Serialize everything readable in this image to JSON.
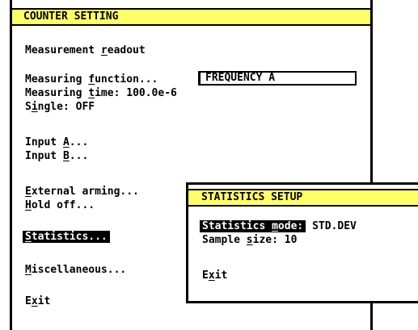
{
  "colors": {
    "titlebar": "#ffff66",
    "text": "#000000",
    "highlight_bg": "#000000",
    "highlight_text": "#ffffff"
  },
  "counter_setting": {
    "title": "COUNTER SETTING",
    "measurement_readout": {
      "label": "Measurement ",
      "hotkey": "r",
      "rest": "eadout"
    },
    "measuring_function": {
      "label": "Measuring ",
      "hotkey": "f",
      "rest": "unction...",
      "value": "FREQUENCY A"
    },
    "measuring_time": {
      "label": "Measuring ",
      "hotkey": "t",
      "rest": "ime: 100.0e-6"
    },
    "single": {
      "label": "S",
      "hotkey": "i",
      "rest": "ngle: OFF"
    },
    "input_a": {
      "label": "Input ",
      "hotkey": "A",
      "rest": "..."
    },
    "input_b": {
      "label": "Input ",
      "hotkey": "B",
      "rest": "..."
    },
    "external_arming": {
      "label": "",
      "hotkey": "E",
      "rest": "xternal arming..."
    },
    "hold_off": {
      "label": "",
      "hotkey": "H",
      "rest": "old off..."
    },
    "statistics": {
      "label": "",
      "hotkey": "S",
      "rest": "tatistics..."
    },
    "miscellaneous": {
      "label": "",
      "hotkey": "M",
      "rest": "iscellaneous..."
    },
    "exit": {
      "label": "E",
      "hotkey": "x",
      "rest": "it"
    }
  },
  "statistics_setup": {
    "title": "STATISTICS SETUP",
    "statistics_mode": {
      "label": "Statistics ",
      "hotkey": "m",
      "rest": "ode:",
      "value": "STD.DEV"
    },
    "sample_size": {
      "label": "Sample ",
      "hotkey": "s",
      "rest": "ize: 10"
    },
    "exit": {
      "label": "E",
      "hotkey": "x",
      "rest": "it"
    }
  }
}
